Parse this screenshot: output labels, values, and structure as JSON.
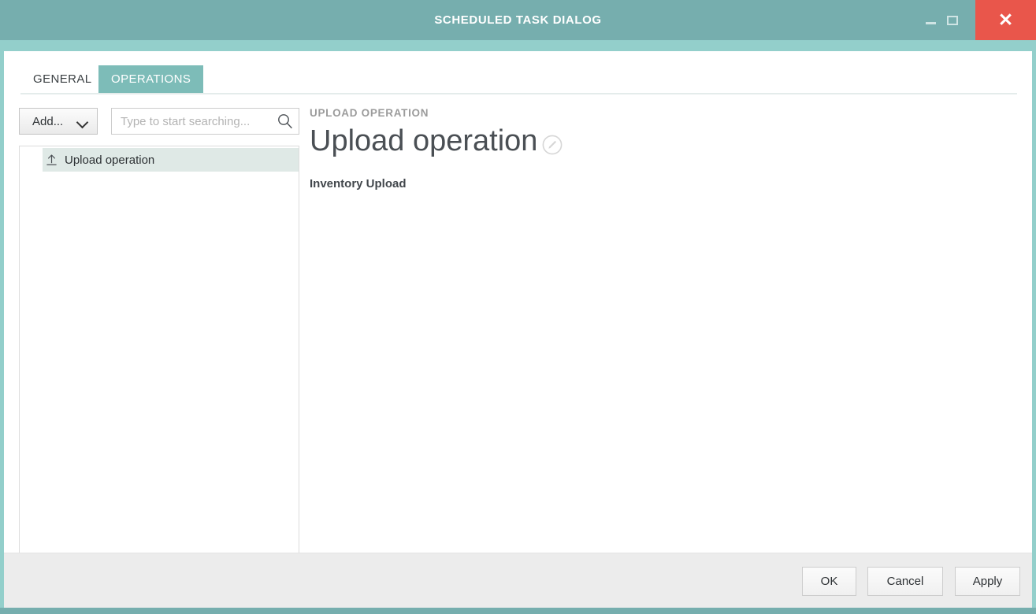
{
  "window": {
    "title": "SCHEDULED TASK DIALOG",
    "controls": {
      "minimize": "minimize",
      "maximize": "maximize",
      "close": "✕"
    },
    "accent_color": "#76aeae",
    "accent_light_color": "#93cfcb",
    "close_color": "#e9564b"
  },
  "tabs": [
    {
      "label": "GENERAL",
      "active": false
    },
    {
      "label": "OPERATIONS",
      "active": true
    }
  ],
  "toolbar": {
    "add_label": "Add...",
    "search_placeholder": "Type to start searching...",
    "search_value": ""
  },
  "list": {
    "items": [
      {
        "label": "Upload operation",
        "icon": "upload-icon",
        "selected": true
      }
    ]
  },
  "detail": {
    "eyebrow": "UPLOAD OPERATION",
    "title": "Upload operation",
    "subtitle": "Inventory Upload"
  },
  "footer": {
    "ok_label": "OK",
    "cancel_label": "Cancel",
    "apply_label": "Apply"
  }
}
